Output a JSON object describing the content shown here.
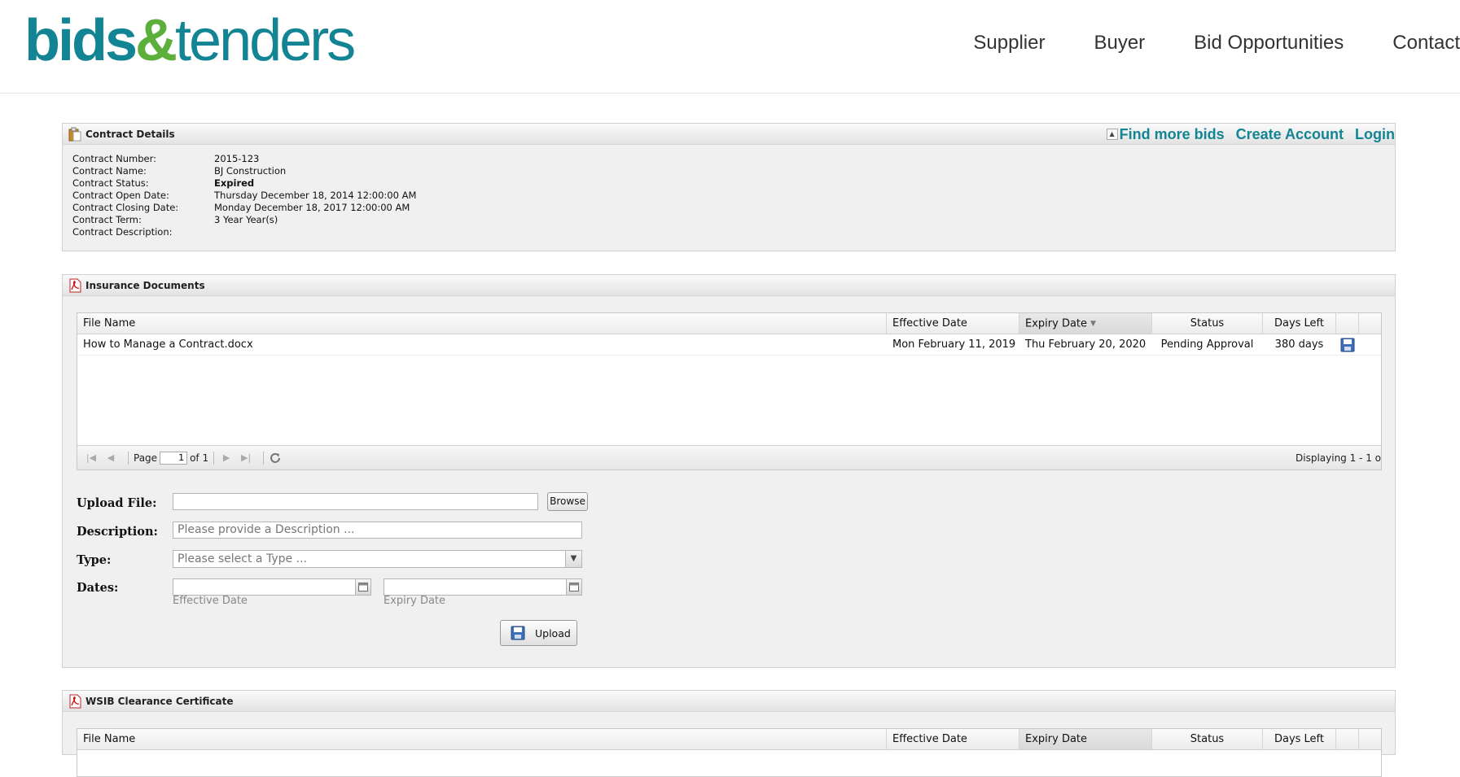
{
  "logo": {
    "part1": "bids",
    "amp": "&",
    "part2": "tenders"
  },
  "nav": {
    "supplier": "Supplier",
    "buyer": "Buyer",
    "bid_opportunities": "Bid Opportunities",
    "contact": "Contact"
  },
  "contract_panel": {
    "title": "Contract Details",
    "links": {
      "find_more_bids": "Find more bids",
      "create_account": "Create Account",
      "login": "Login"
    },
    "rows": [
      {
        "label": "Contract Number:",
        "value": "2015-123"
      },
      {
        "label": "Contract Name:",
        "value": "BJ Construction"
      },
      {
        "label": "Contract Status:",
        "value": "Expired"
      },
      {
        "label": "Contract Open Date:",
        "value": "Thursday December 18, 2014 12:00:00 AM"
      },
      {
        "label": "Contract Closing Date:",
        "value": "Monday December 18, 2017 12:00:00 AM"
      },
      {
        "label": "Contract Term:",
        "value": "3 Year Year(s)"
      },
      {
        "label": "Contract Description:",
        "value": ""
      }
    ]
  },
  "insurance_panel": {
    "title": "Insurance Documents",
    "columns": {
      "file_name": "File Name",
      "effective_date": "Effective Date",
      "expiry_date": "Expiry Date",
      "status": "Status",
      "days_left": "Days Left"
    },
    "rows": [
      {
        "file_name": "How to Manage a Contract.docx",
        "effective_date": "Mon February 11, 2019",
        "expiry_date": "Thu February 20, 2020",
        "status": "Pending Approval",
        "days_left": "380 days"
      }
    ],
    "pager": {
      "page_label": "Page",
      "page_value": "1",
      "of_label": "of 1",
      "displaying": "Displaying 1 - 1 o"
    },
    "form": {
      "upload_file_label": "Upload File:",
      "browse_label": "Browse",
      "description_label": "Description:",
      "description_placeholder": "Please provide a Description ...",
      "type_label": "Type:",
      "type_placeholder": "Please select a Type ...",
      "dates_label": "Dates:",
      "effective_date_caption": "Effective Date",
      "expiry_date_caption": "Expiry Date",
      "upload_button": "Upload"
    }
  },
  "wsib_panel": {
    "title": "WSIB Clearance Certificate",
    "columns": {
      "file_name": "File Name",
      "effective_date": "Effective Date",
      "expiry_date": "Expiry Date",
      "status": "Status",
      "days_left": "Days Left"
    }
  },
  "colors": {
    "brand_teal": "#138493",
    "brand_green": "#5daf3c",
    "panel_bg": "#f0f0f0"
  }
}
